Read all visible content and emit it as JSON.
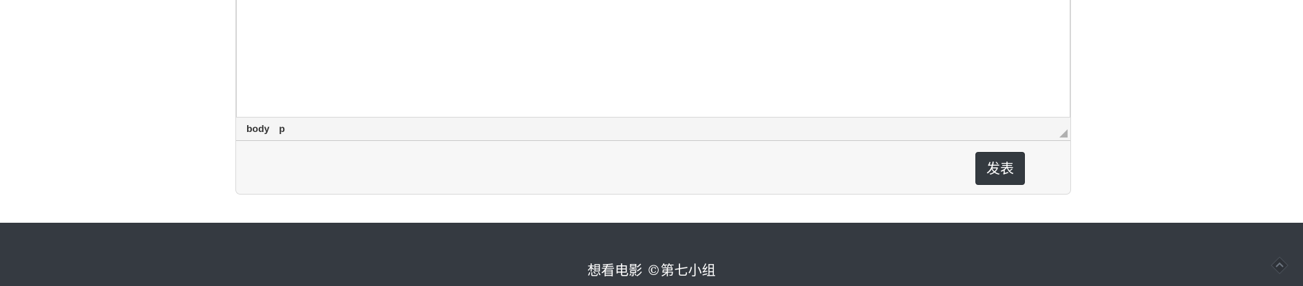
{
  "editor": {
    "path": [
      "body",
      "p"
    ]
  },
  "actions": {
    "publish_label": "发表"
  },
  "footer": {
    "text": "想看电影  ©第七小组"
  },
  "icons": {
    "resize": "resize-grip-icon",
    "scroll_top": "scroll-to-top-icon"
  },
  "colors": {
    "button_bg": "#343a40",
    "footer_bg": "#353a41",
    "card_bg": "#f7f7f7"
  }
}
